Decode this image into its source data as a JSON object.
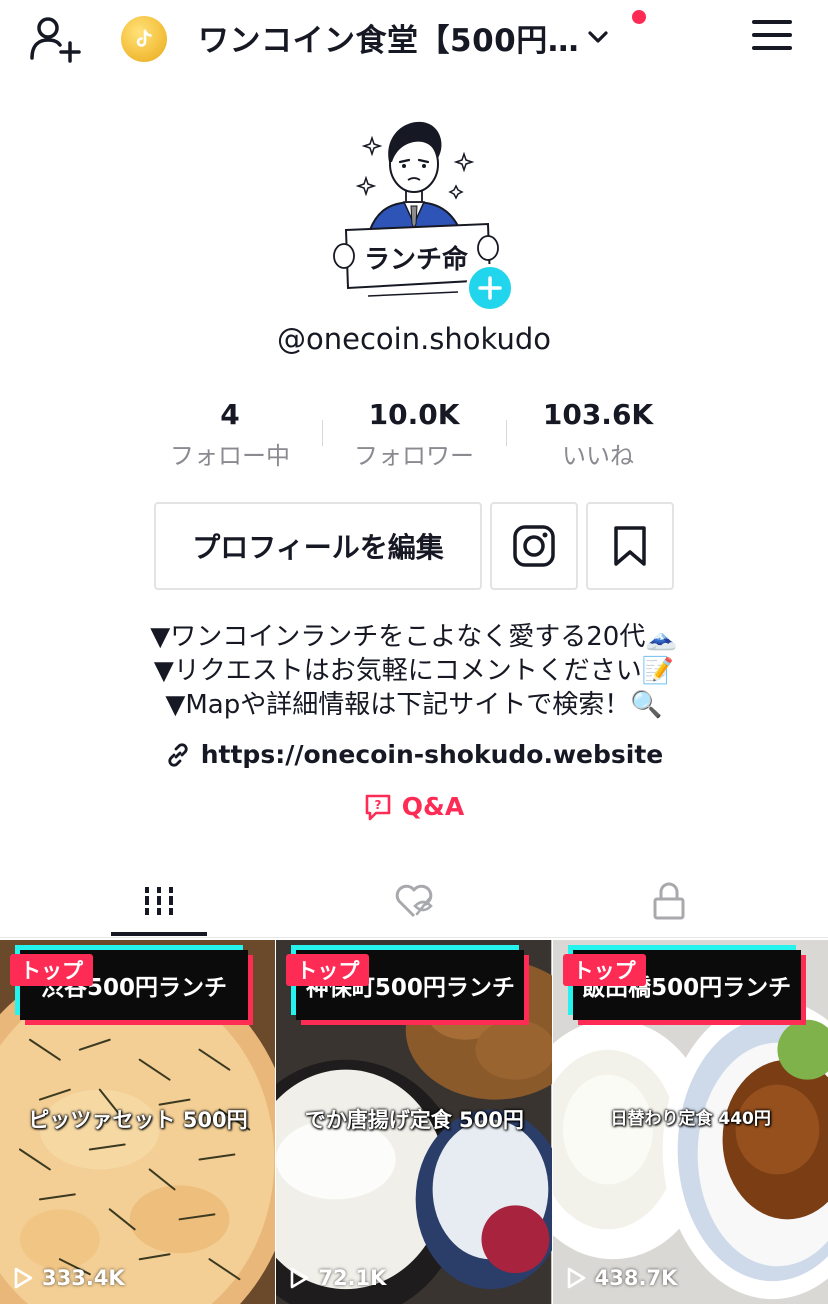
{
  "header": {
    "title": "ワンコイン食堂【500円…",
    "accent_color": "#fe2c55",
    "icons": [
      "add-user-icon",
      "coin-icon",
      "chevron-down-icon",
      "menu-icon"
    ]
  },
  "profile": {
    "username": "@onecoin.shokudo",
    "avatar_sign_text": "ランチ命",
    "stats": [
      {
        "value": "4",
        "label": "フォロー中"
      },
      {
        "value": "10.0K",
        "label": "フォロワー"
      },
      {
        "value": "103.6K",
        "label": "いいね"
      }
    ],
    "edit_button": "プロフィールを編集",
    "bio_lines": [
      "▼ワンコインランチをこよなく愛する20代🗻",
      "▼リクエストはお気軽にコメントください📝",
      "▼Mapや詳細情報は下記サイトで検索！🔍"
    ],
    "link": "https://onecoin-shokudo.website",
    "qa_label": "Q&A"
  },
  "tabs": [
    {
      "name": "videos",
      "icon": "grid-icon",
      "active": true
    },
    {
      "name": "liked",
      "icon": "heart-hidden-icon",
      "active": false
    },
    {
      "name": "private",
      "icon": "lock-icon",
      "active": false
    }
  ],
  "videos": [
    {
      "badge": "トップ",
      "caption": "渋谷500円ランチ",
      "dish": "ピッツァセット 500円",
      "views": "333.4K"
    },
    {
      "badge": "トップ",
      "caption": "神保町500円ランチ",
      "dish": "でか唐揚げ定食 500円",
      "views": "72.1K"
    },
    {
      "badge": "トップ",
      "caption": "飯田橋500円ランチ",
      "dish": "日替わり定食 440円",
      "views": "438.7K"
    }
  ]
}
